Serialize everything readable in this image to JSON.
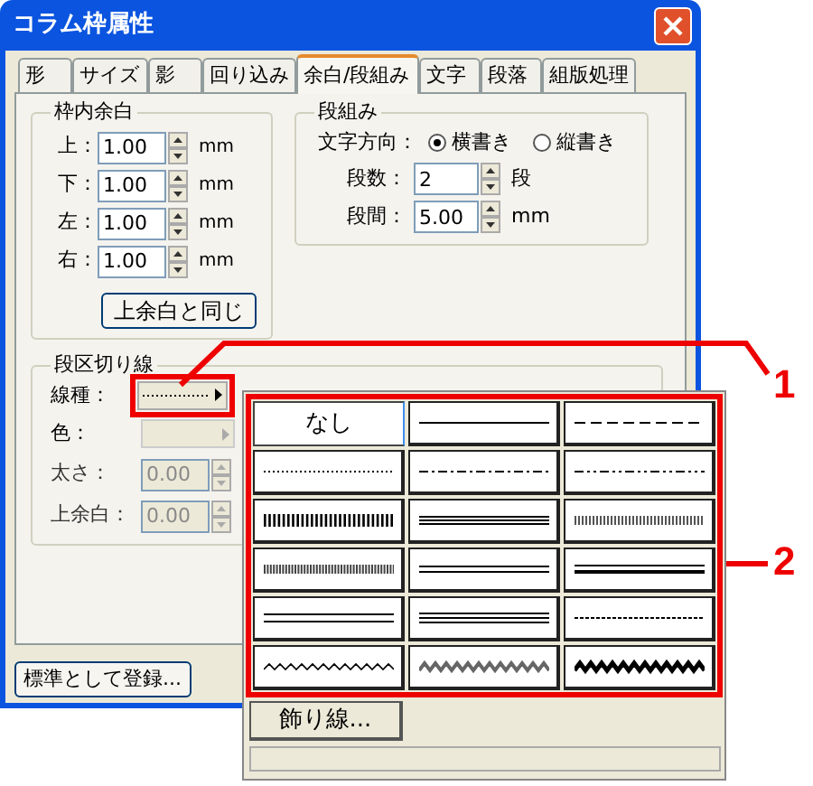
{
  "window": {
    "title": "コラム枠属性"
  },
  "tabs": [
    {
      "label": "形",
      "selected": false
    },
    {
      "label": "サイズ",
      "selected": false
    },
    {
      "label": "影",
      "selected": false
    },
    {
      "label": "回り込み",
      "selected": false
    },
    {
      "label": "余白/段組み",
      "selected": true
    },
    {
      "label": "文字",
      "selected": false
    },
    {
      "label": "段落",
      "selected": false
    },
    {
      "label": "組版処理",
      "selected": false
    }
  ],
  "margins": {
    "title": "枠内余白",
    "fields": [
      {
        "label": "上：",
        "value": "1.00",
        "unit": "mm"
      },
      {
        "label": "下：",
        "value": "1.00",
        "unit": "mm"
      },
      {
        "label": "左：",
        "value": "1.00",
        "unit": "mm"
      },
      {
        "label": "右：",
        "value": "1.00",
        "unit": "mm"
      }
    ],
    "button": "上余白と同じ"
  },
  "columns": {
    "title": "段組み",
    "direction_label": "文字方向：",
    "directions": [
      {
        "label": "横書き",
        "selected": true
      },
      {
        "label": "縦書き",
        "selected": false
      }
    ],
    "fields": [
      {
        "label": "段数：",
        "value": "2",
        "unit": "段"
      },
      {
        "label": "段間：",
        "value": "5.00",
        "unit": "mm"
      }
    ]
  },
  "divider": {
    "title": "段区切り線",
    "line_type_label": "線種：",
    "line_type": {
      "kind": "dotted"
    },
    "color_label": "色：",
    "color_disabled": true,
    "fields": [
      {
        "label": "太さ：",
        "value": "0.00",
        "disabled": true
      },
      {
        "label": "上余白：",
        "value": "0.00",
        "disabled": true
      }
    ]
  },
  "buttons": [
    "標準として登録..."
  ],
  "line_popup": {
    "options": [
      {
        "kind": "text",
        "label": "なし",
        "selected": true
      },
      {
        "kind": "solid",
        "selected": false
      },
      {
        "kind": "dashed",
        "selected": false
      },
      {
        "kind": "dotted",
        "selected": false
      },
      {
        "kind": "dash-dot",
        "selected": false
      },
      {
        "kind": "dash-dot-dot",
        "selected": false
      },
      {
        "kind": "bars",
        "selected": false
      },
      {
        "kind": "triple",
        "selected": false
      },
      {
        "kind": "diagonal-hatch",
        "selected": false
      },
      {
        "kind": "cross-hatch",
        "selected": false
      },
      {
        "kind": "double",
        "selected": false
      },
      {
        "kind": "double-thick",
        "selected": false
      },
      {
        "kind": "double-wide",
        "selected": false
      },
      {
        "kind": "triple-thin",
        "selected": false
      },
      {
        "kind": "dashed-fine",
        "selected": false
      },
      {
        "kind": "wave",
        "selected": false
      },
      {
        "kind": "wave-gray",
        "selected": false
      },
      {
        "kind": "wave-bold",
        "selected": false
      }
    ],
    "more_button": "飾り線..."
  },
  "callouts": [
    "1",
    "2"
  ]
}
